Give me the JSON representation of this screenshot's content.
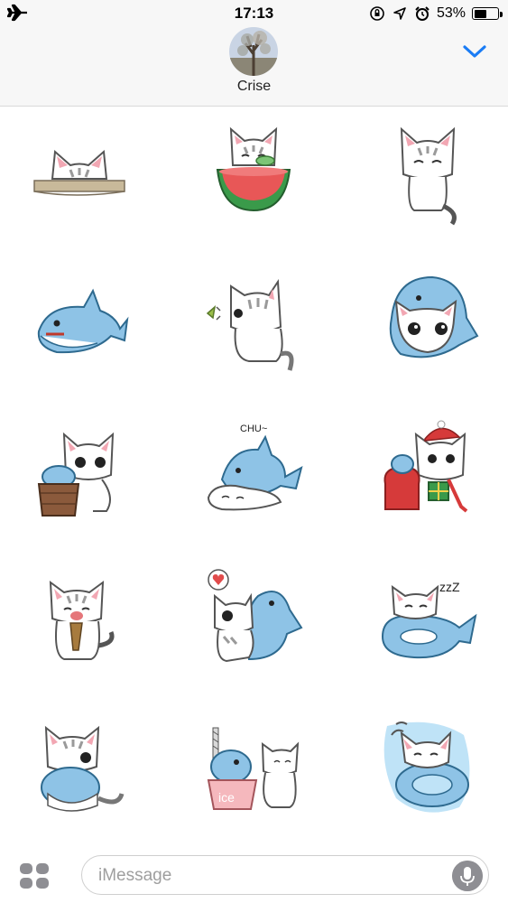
{
  "status_bar": {
    "left_icon": "airplane-icon",
    "time": "17:13",
    "icons": [
      "orientation-lock-icon",
      "location-icon",
      "alarm-icon"
    ],
    "battery_percent_label": "53%",
    "battery_level": 0.53
  },
  "header": {
    "contact_name": "Crise",
    "avatar": "tree-photo-avatar",
    "collapse_icon": "chevron-down-icon",
    "accent_color": "#1a7cf5"
  },
  "stickers": [
    {
      "name": "cat-peeking-over-wall"
    },
    {
      "name": "cat-eating-watermelon"
    },
    {
      "name": "cat-sitting-content"
    },
    {
      "name": "shark-plush"
    },
    {
      "name": "cat-sniffing-leaf"
    },
    {
      "name": "cat-in-shark-hood"
    },
    {
      "name": "cat-shark-in-bucket"
    },
    {
      "name": "shark-kissing-sleeping-cat",
      "label": "CHU~"
    },
    {
      "name": "cat-christmas-gift"
    },
    {
      "name": "cat-eating-fish"
    },
    {
      "name": "cat-hugging-shark-heart"
    },
    {
      "name": "cat-sleeping-on-shark",
      "label": "zzZ"
    },
    {
      "name": "cat-hugging-shark-pillow"
    },
    {
      "name": "shark-ice-cream-cup",
      "label": "ice"
    },
    {
      "name": "cat-floating-on-shark-ring"
    }
  ],
  "input_bar": {
    "apps_icon": "app-drawer-icon",
    "placeholder": "iMessage",
    "mic_icon": "microphone-icon"
  }
}
